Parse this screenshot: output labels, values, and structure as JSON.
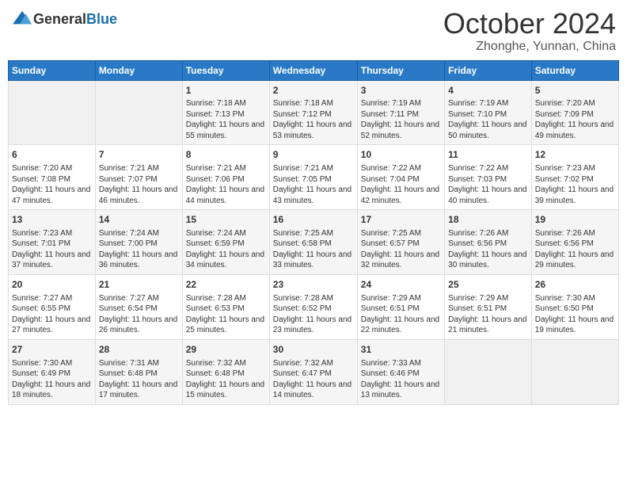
{
  "header": {
    "logo_general": "General",
    "logo_blue": "Blue",
    "month_title": "October 2024",
    "location": "Zhonghe, Yunnan, China"
  },
  "days_of_week": [
    "Sunday",
    "Monday",
    "Tuesday",
    "Wednesday",
    "Thursday",
    "Friday",
    "Saturday"
  ],
  "weeks": [
    [
      {
        "day": null
      },
      {
        "day": null
      },
      {
        "day": "1",
        "sunrise": "7:18 AM",
        "sunset": "7:13 PM",
        "daylight": "11 hours and 55 minutes."
      },
      {
        "day": "2",
        "sunrise": "7:18 AM",
        "sunset": "7:12 PM",
        "daylight": "11 hours and 53 minutes."
      },
      {
        "day": "3",
        "sunrise": "7:19 AM",
        "sunset": "7:11 PM",
        "daylight": "11 hours and 52 minutes."
      },
      {
        "day": "4",
        "sunrise": "7:19 AM",
        "sunset": "7:10 PM",
        "daylight": "11 hours and 50 minutes."
      },
      {
        "day": "5",
        "sunrise": "7:20 AM",
        "sunset": "7:09 PM",
        "daylight": "11 hours and 49 minutes."
      }
    ],
    [
      {
        "day": "6",
        "sunrise": "7:20 AM",
        "sunset": "7:08 PM",
        "daylight": "11 hours and 47 minutes."
      },
      {
        "day": "7",
        "sunrise": "7:21 AM",
        "sunset": "7:07 PM",
        "daylight": "11 hours and 46 minutes."
      },
      {
        "day": "8",
        "sunrise": "7:21 AM",
        "sunset": "7:06 PM",
        "daylight": "11 hours and 44 minutes."
      },
      {
        "day": "9",
        "sunrise": "7:21 AM",
        "sunset": "7:05 PM",
        "daylight": "11 hours and 43 minutes."
      },
      {
        "day": "10",
        "sunrise": "7:22 AM",
        "sunset": "7:04 PM",
        "daylight": "11 hours and 42 minutes."
      },
      {
        "day": "11",
        "sunrise": "7:22 AM",
        "sunset": "7:03 PM",
        "daylight": "11 hours and 40 minutes."
      },
      {
        "day": "12",
        "sunrise": "7:23 AM",
        "sunset": "7:02 PM",
        "daylight": "11 hours and 39 minutes."
      }
    ],
    [
      {
        "day": "13",
        "sunrise": "7:23 AM",
        "sunset": "7:01 PM",
        "daylight": "11 hours and 37 minutes."
      },
      {
        "day": "14",
        "sunrise": "7:24 AM",
        "sunset": "7:00 PM",
        "daylight": "11 hours and 36 minutes."
      },
      {
        "day": "15",
        "sunrise": "7:24 AM",
        "sunset": "6:59 PM",
        "daylight": "11 hours and 34 minutes."
      },
      {
        "day": "16",
        "sunrise": "7:25 AM",
        "sunset": "6:58 PM",
        "daylight": "11 hours and 33 minutes."
      },
      {
        "day": "17",
        "sunrise": "7:25 AM",
        "sunset": "6:57 PM",
        "daylight": "11 hours and 32 minutes."
      },
      {
        "day": "18",
        "sunrise": "7:26 AM",
        "sunset": "6:56 PM",
        "daylight": "11 hours and 30 minutes."
      },
      {
        "day": "19",
        "sunrise": "7:26 AM",
        "sunset": "6:56 PM",
        "daylight": "11 hours and 29 minutes."
      }
    ],
    [
      {
        "day": "20",
        "sunrise": "7:27 AM",
        "sunset": "6:55 PM",
        "daylight": "11 hours and 27 minutes."
      },
      {
        "day": "21",
        "sunrise": "7:27 AM",
        "sunset": "6:54 PM",
        "daylight": "11 hours and 26 minutes."
      },
      {
        "day": "22",
        "sunrise": "7:28 AM",
        "sunset": "6:53 PM",
        "daylight": "11 hours and 25 minutes."
      },
      {
        "day": "23",
        "sunrise": "7:28 AM",
        "sunset": "6:52 PM",
        "daylight": "11 hours and 23 minutes."
      },
      {
        "day": "24",
        "sunrise": "7:29 AM",
        "sunset": "6:51 PM",
        "daylight": "11 hours and 22 minutes."
      },
      {
        "day": "25",
        "sunrise": "7:29 AM",
        "sunset": "6:51 PM",
        "daylight": "11 hours and 21 minutes."
      },
      {
        "day": "26",
        "sunrise": "7:30 AM",
        "sunset": "6:50 PM",
        "daylight": "11 hours and 19 minutes."
      }
    ],
    [
      {
        "day": "27",
        "sunrise": "7:30 AM",
        "sunset": "6:49 PM",
        "daylight": "11 hours and 18 minutes."
      },
      {
        "day": "28",
        "sunrise": "7:31 AM",
        "sunset": "6:48 PM",
        "daylight": "11 hours and 17 minutes."
      },
      {
        "day": "29",
        "sunrise": "7:32 AM",
        "sunset": "6:48 PM",
        "daylight": "11 hours and 15 minutes."
      },
      {
        "day": "30",
        "sunrise": "7:32 AM",
        "sunset": "6:47 PM",
        "daylight": "11 hours and 14 minutes."
      },
      {
        "day": "31",
        "sunrise": "7:33 AM",
        "sunset": "6:46 PM",
        "daylight": "11 hours and 13 minutes."
      },
      {
        "day": null
      },
      {
        "day": null
      }
    ]
  ]
}
